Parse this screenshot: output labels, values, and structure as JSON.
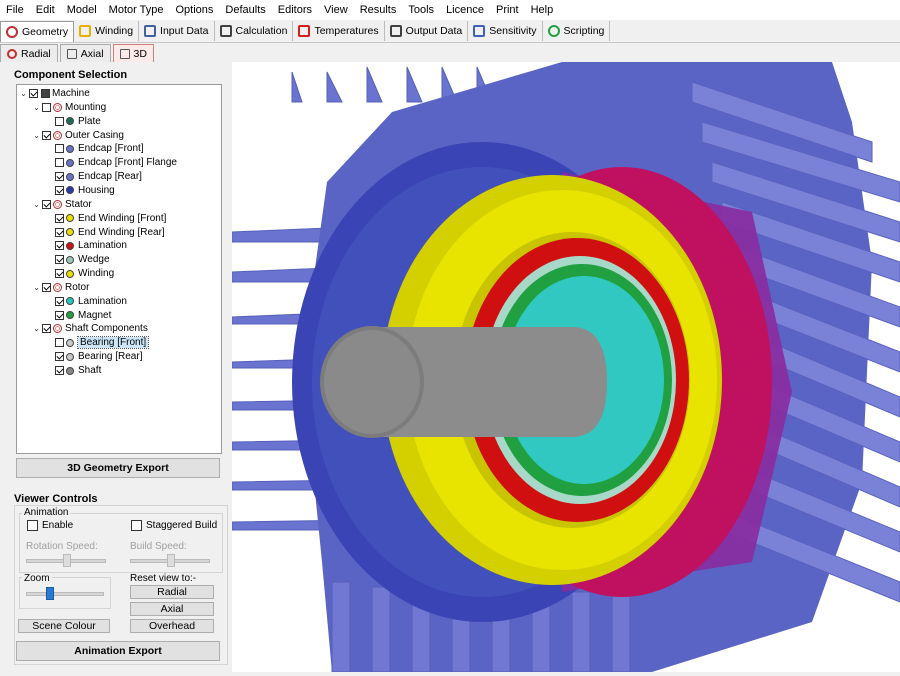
{
  "menu": [
    "File",
    "Edit",
    "Model",
    "Motor Type",
    "Options",
    "Defaults",
    "Editors",
    "View",
    "Results",
    "Tools",
    "Licence",
    "Print",
    "Help"
  ],
  "tabs": [
    {
      "label": "Geometry",
      "icon": "geometry-icon",
      "color": "#c03030"
    },
    {
      "label": "Winding",
      "icon": "winding-icon",
      "color": "#e8b000"
    },
    {
      "label": "Input Data",
      "icon": "input-data-icon",
      "color": "#4060a0"
    },
    {
      "label": "Calculation",
      "icon": "calculation-icon",
      "color": "#404040"
    },
    {
      "label": "Temperatures",
      "icon": "thermometer-icon",
      "color": "#d02020"
    },
    {
      "label": "Output Data",
      "icon": "output-data-icon",
      "color": "#404040"
    },
    {
      "label": "Sensitivity",
      "icon": "sensitivity-icon",
      "color": "#4060c0"
    },
    {
      "label": "Scripting",
      "icon": "scripting-icon",
      "color": "#20a040"
    }
  ],
  "subtabs": [
    {
      "label": "Radial",
      "icon": "radial-icon"
    },
    {
      "label": "Axial",
      "icon": "axial-icon"
    },
    {
      "label": "3D",
      "icon": "3d-icon"
    }
  ],
  "component_selection": {
    "title": "Component Selection",
    "tree": [
      {
        "label": "Machine",
        "level": 0,
        "checked": true,
        "expander": true,
        "icon": "machine"
      },
      {
        "label": "Mounting",
        "level": 1,
        "checked": false,
        "expander": true,
        "icon": "group"
      },
      {
        "label": "Plate",
        "level": 2,
        "checked": false,
        "icon": "dot",
        "color": "#1d6b5a"
      },
      {
        "label": "Outer Casing",
        "level": 1,
        "checked": true,
        "expander": true,
        "icon": "group"
      },
      {
        "label": "Endcap [Front]",
        "level": 2,
        "checked": false,
        "icon": "dot",
        "color": "#6a72c8"
      },
      {
        "label": "Endcap [Front] Flange",
        "level": 2,
        "checked": false,
        "icon": "dot",
        "color": "#6a72c8"
      },
      {
        "label": "Endcap [Rear]",
        "level": 2,
        "checked": true,
        "icon": "dot",
        "color": "#6a72c8"
      },
      {
        "label": "Housing",
        "level": 2,
        "checked": true,
        "icon": "dot",
        "color": "#2a3aa8"
      },
      {
        "label": "Stator",
        "level": 1,
        "checked": true,
        "expander": true,
        "icon": "group"
      },
      {
        "label": "End Winding [Front]",
        "level": 2,
        "checked": true,
        "icon": "dot",
        "color": "#e8e000"
      },
      {
        "label": "End Winding [Rear]",
        "level": 2,
        "checked": true,
        "icon": "dot",
        "color": "#e8e000"
      },
      {
        "label": "Lamination",
        "level": 2,
        "checked": true,
        "icon": "dot",
        "color": "#d01010"
      },
      {
        "label": "Wedge",
        "level": 2,
        "checked": true,
        "icon": "dot",
        "color": "#9ac8b8"
      },
      {
        "label": "Winding",
        "level": 2,
        "checked": true,
        "icon": "dot",
        "color": "#e8e000"
      },
      {
        "label": "Rotor",
        "level": 1,
        "checked": true,
        "expander": true,
        "icon": "group"
      },
      {
        "label": "Lamination",
        "level": 2,
        "checked": true,
        "icon": "dot",
        "color": "#20c8c0"
      },
      {
        "label": "Magnet",
        "level": 2,
        "checked": true,
        "icon": "dot",
        "color": "#20a040"
      },
      {
        "label": "Shaft Components",
        "level": 1,
        "checked": true,
        "expander": true,
        "icon": "group"
      },
      {
        "label": "Bearing [Front]",
        "level": 2,
        "checked": false,
        "icon": "dot",
        "color": "#c8c8c8",
        "selected": true
      },
      {
        "label": "Bearing [Rear]",
        "level": 2,
        "checked": true,
        "icon": "dot",
        "color": "#c8c8c8"
      },
      {
        "label": "Shaft",
        "level": 2,
        "checked": true,
        "icon": "dot",
        "color": "#888888"
      }
    ],
    "export_button": "3D Geometry Export"
  },
  "viewer_controls": {
    "title": "Viewer Controls",
    "animation_title": "Animation",
    "enable_label": "Enable",
    "staggered_label": "Staggered Build",
    "rotation_speed_label": "Rotation Speed:",
    "build_speed_label": "Build Speed:",
    "zoom_label": "Zoom",
    "reset_label": "Reset view to:-",
    "radial_button": "Radial",
    "axial_button": "Axial",
    "overhead_button": "Overhead",
    "scene_colour_button": "Scene Colour",
    "animation_export_button": "Animation Export"
  }
}
